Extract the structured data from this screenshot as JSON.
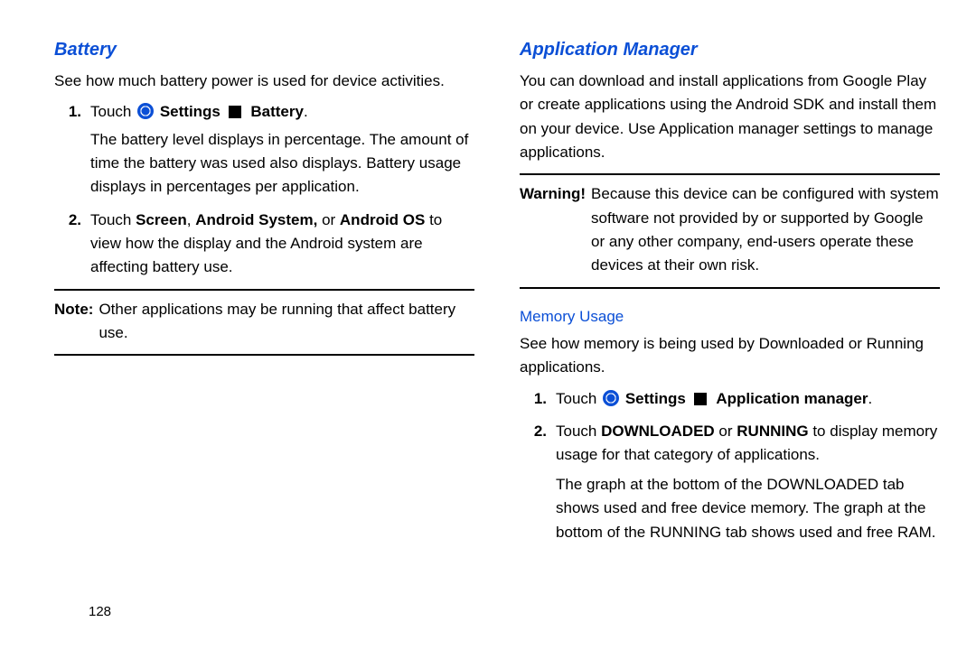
{
  "page_number": "128",
  "left": {
    "heading": "Battery",
    "intro": "See how much battery power is used for device activities.",
    "step1_num": "1.",
    "step1_a": "Touch ",
    "step1_settings": "Settings",
    "step1_target": "Battery",
    "step1_dot": ".",
    "step1_desc": "The battery level displays in percentage. The amount of time the battery was used also displays. Battery usage displays in percentages per application.",
    "step2_num": "2.",
    "step2_a": "Touch ",
    "step2_b1": "Screen",
    "step2_c": ", ",
    "step2_b2": "Android System,",
    "step2_d": " or ",
    "step2_b3": "Android OS",
    "step2_e": " to view how the display and the Android system are affecting battery use.",
    "note_label": "Note:",
    "note_body": "Other applications may be running that affect battery use."
  },
  "right": {
    "heading": "Application Manager",
    "intro": "You can download and install applications from Google Play or create applications using the Android SDK and install them on your device. Use Application manager settings to manage applications.",
    "warn_label": "Warning!",
    "warn_body": "Because this device can be configured with system software not provided by or supported by Google or any other company, end-users operate these devices at their own risk.",
    "sub": "Memory Usage",
    "sub_intro": "See how memory is being used by Downloaded or Running applications.",
    "step1_num": "1.",
    "step1_a": "Touch ",
    "step1_settings": "Settings",
    "step1_target": "Application manager",
    "step1_dot": ".",
    "step2_num": "2.",
    "step2_a": "Touch ",
    "step2_b1": "DOWNLOADED",
    "step2_c": " or ",
    "step2_b2": "RUNNING",
    "step2_d": " to display memory usage for that category of applications.",
    "step2_desc": "The graph at the bottom of the DOWNLOADED tab shows used and free device memory. The graph at the bottom of the RUNNING tab shows used and free RAM."
  }
}
